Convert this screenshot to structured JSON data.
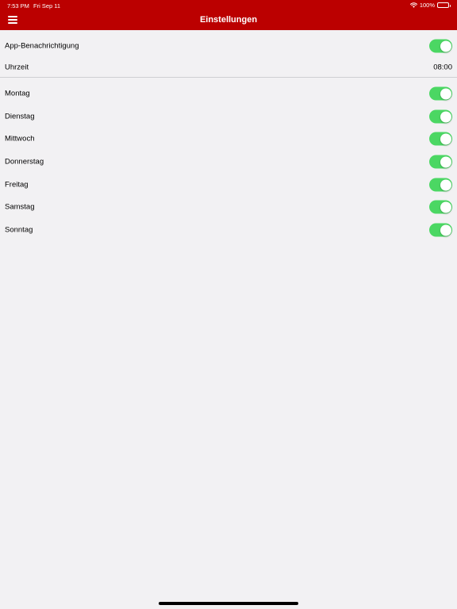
{
  "status_bar": {
    "time": "7:53 PM",
    "date": "Fri Sep 11",
    "battery": "100%"
  },
  "nav": {
    "title": "Einstellungen"
  },
  "settings": {
    "notification_label": "App-Benachrichtigung",
    "notification_on": true,
    "time_label": "Uhrzeit",
    "time_value": "08:00"
  },
  "days": [
    {
      "label": "Montag",
      "on": true
    },
    {
      "label": "Dienstag",
      "on": true
    },
    {
      "label": "Mittwoch",
      "on": true
    },
    {
      "label": "Donnerstag",
      "on": true
    },
    {
      "label": "Freitag",
      "on": true
    },
    {
      "label": "Samstag",
      "on": true
    },
    {
      "label": "Sonntag",
      "on": true
    }
  ],
  "colors": {
    "accent": "#bb0000",
    "toggle_on": "#4bd763",
    "background": "#f2f1f3"
  }
}
